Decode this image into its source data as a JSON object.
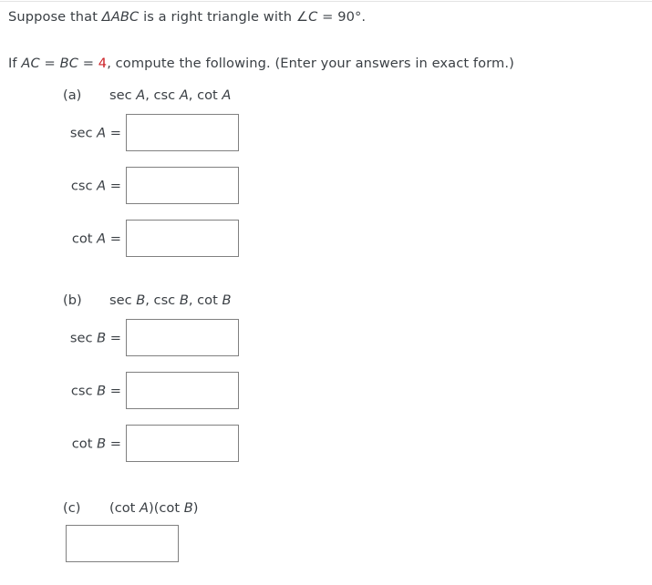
{
  "problem": {
    "line1_pre": "Suppose that ",
    "line1_triangle": "ΔABC",
    "line1_mid": " is a right triangle with ",
    "line1_angle": "∠C",
    "line1_post": " = 90°.",
    "line2_pre": "If ",
    "line2_ac": "AC",
    "line2_eq1": " = ",
    "line2_bc": "BC",
    "line2_eq2": " = ",
    "line2_value": "4",
    "line2_post": ", compute the following. (Enter your answers in exact form.)"
  },
  "parts": [
    {
      "letter": "(a)",
      "expression": "sec A, csc A, cot A",
      "expr_tokens": [
        "sec ",
        "A",
        ", csc ",
        "A",
        ", cot ",
        "A"
      ],
      "answers": [
        {
          "label": "sec A =",
          "label_fn": "sec ",
          "label_var": "A",
          "label_eq": " =",
          "value": "",
          "placeholder": ""
        },
        {
          "label": "csc A =",
          "label_fn": "csc ",
          "label_var": "A",
          "label_eq": " =",
          "value": "",
          "placeholder": ""
        },
        {
          "label": "cot A =",
          "label_fn": "cot ",
          "label_var": "A",
          "label_eq": " =",
          "value": "",
          "placeholder": ""
        }
      ]
    },
    {
      "letter": "(b)",
      "expression": "sec B, csc B, cot B",
      "expr_tokens": [
        "sec ",
        "B",
        ", csc ",
        "B",
        ", cot ",
        "B"
      ],
      "answers": [
        {
          "label": "sec B =",
          "label_fn": "sec ",
          "label_var": "B",
          "label_eq": " =",
          "value": "",
          "placeholder": ""
        },
        {
          "label": "csc B =",
          "label_fn": "csc ",
          "label_var": "B",
          "label_eq": " =",
          "value": "",
          "placeholder": ""
        },
        {
          "label": "cot B =",
          "label_fn": "cot ",
          "label_var": "B",
          "label_eq": " =",
          "value": "",
          "placeholder": ""
        }
      ]
    },
    {
      "letter": "(c)",
      "expression": "(cot A)(cot B)",
      "expr_tokens": [
        "(cot ",
        "A",
        ")(cot ",
        "B",
        ")"
      ],
      "answers": [
        {
          "label": "",
          "label_fn": "",
          "label_var": "",
          "label_eq": "",
          "value": "",
          "placeholder": ""
        }
      ]
    }
  ],
  "colors": {
    "text": "#3a3f44",
    "highlight_number": "#cc2127",
    "input_border": "#808080",
    "divider": "#e3e3e3"
  }
}
